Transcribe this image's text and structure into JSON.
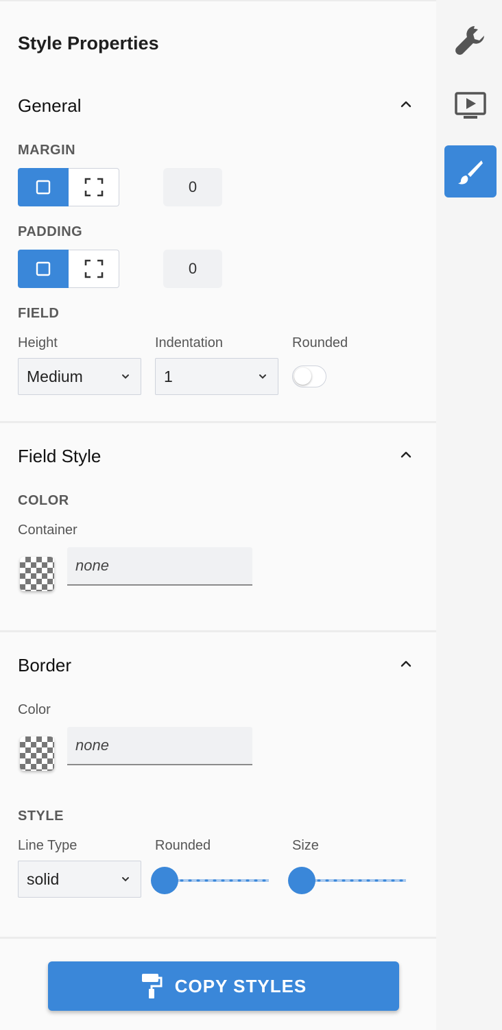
{
  "panel": {
    "title": "Style Properties"
  },
  "rail": {
    "icons": [
      "wrench-icon",
      "preview-icon",
      "brush-icon"
    ],
    "active_color": "#3a87d9"
  },
  "general": {
    "title": "General",
    "margin": {
      "label": "MARGIN",
      "value": "0"
    },
    "padding": {
      "label": "PADDING",
      "value": "0"
    },
    "field": {
      "label": "FIELD",
      "height_label": "Height",
      "height_value": "Medium",
      "indentation_label": "Indentation",
      "indentation_value": "1",
      "rounded_label": "Rounded",
      "rounded_on": false
    }
  },
  "field_style": {
    "title": "Field Style",
    "color_label": "COLOR",
    "container_label": "Container",
    "container_value": "none"
  },
  "border": {
    "title": "Border",
    "color_label": "Color",
    "color_value": "none",
    "style_label": "STYLE",
    "line_type_label": "Line Type",
    "line_type_value": "solid",
    "rounded_label": "Rounded",
    "rounded_value": 0,
    "size_label": "Size",
    "size_value": 0
  },
  "copy_button": {
    "label": "COPY STYLES"
  },
  "colors": {
    "accent": "#3a87d9"
  }
}
